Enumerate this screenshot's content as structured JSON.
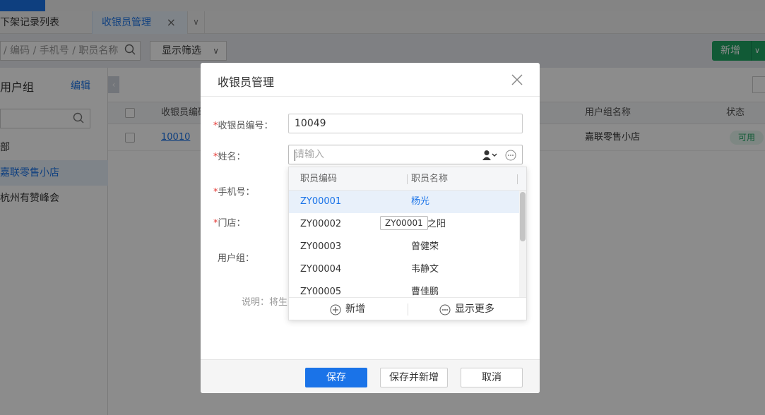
{
  "tabs": [
    {
      "label": "下架记录列表"
    },
    {
      "label": "收银员管理"
    }
  ],
  "toolbar": {
    "search_placeholder": "/ 编码 / 手机号 / 职员名称",
    "filter_label": "显示筛选",
    "add_label": "新增"
  },
  "left_panel": {
    "title": "用户组",
    "edit_label": "编辑",
    "items": [
      "部",
      "嘉联零售小店",
      "杭州有赞峰会"
    ]
  },
  "table": {
    "headers": [
      "收银员编码",
      "用户组名称",
      "状态"
    ],
    "rows": [
      {
        "code": "10010",
        "group": "嘉联零售小店",
        "status": "可用"
      }
    ]
  },
  "modal": {
    "title": "收银员管理",
    "fields": {
      "code_label": "收银员编号：",
      "code_value": "10049",
      "name_label": "姓名：",
      "name_placeholder": "请输入",
      "phone_label": "手机号：",
      "store_label": "门店：",
      "group_label": "用户组："
    },
    "note": "说明：将生",
    "buttons": {
      "save": "保存",
      "save_new": "保存并新增",
      "cancel": "取消"
    }
  },
  "dropdown": {
    "col_code": "职员编码",
    "col_name": "职员名称",
    "rows": [
      {
        "code": "ZY00001",
        "name": "杨光"
      },
      {
        "code": "ZY00002",
        "name": "之阳"
      },
      {
        "code": "ZY00003",
        "name": "曾健荣"
      },
      {
        "code": "ZY00004",
        "name": "韦静文"
      },
      {
        "code": "ZY00005",
        "name": "曹佳鹏"
      }
    ],
    "add_label": "新增",
    "more_label": "显示更多",
    "tooltip": "ZY00001"
  },
  "colors": {
    "primary": "#1a73e8",
    "success": "#1fa463",
    "required": "#e53935"
  }
}
